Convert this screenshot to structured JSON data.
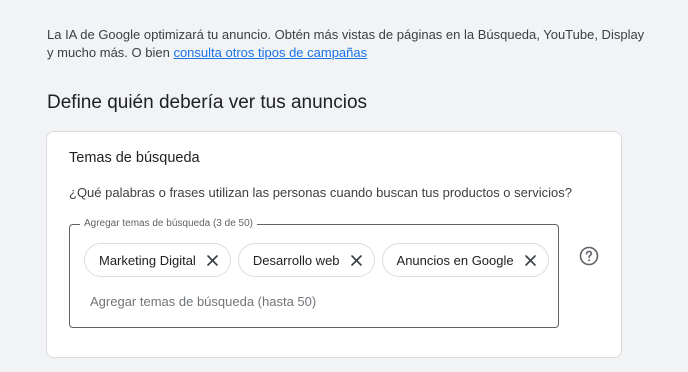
{
  "intro": {
    "text": "La IA de Google optimizará tu anuncio. Obtén más vistas de páginas en la Búsqueda, YouTube, Display y mucho más. O bien ",
    "link_label": "consulta otros tipos de campañas"
  },
  "section": {
    "title": "Define quién debería ver tus anuncios"
  },
  "card": {
    "title": "Temas de búsqueda",
    "question": "¿Qué palabras o frases utilizan las personas cuando buscan tus productos o servicios?",
    "field_legend": "Agregar temas de búsqueda (3 de 50)",
    "chips": [
      {
        "label": "Marketing Digital"
      },
      {
        "label": "Desarrollo web"
      },
      {
        "label": "Anuncios en Google"
      }
    ],
    "input_placeholder": "Agregar temas de búsqueda (hasta 50)",
    "input_value": ""
  },
  "icons": {
    "chip_remove": "close-icon",
    "help": "help-circle-icon"
  },
  "colors": {
    "link": "#1a73e8",
    "background": "#f1f3f4",
    "border": "#dadce0"
  }
}
